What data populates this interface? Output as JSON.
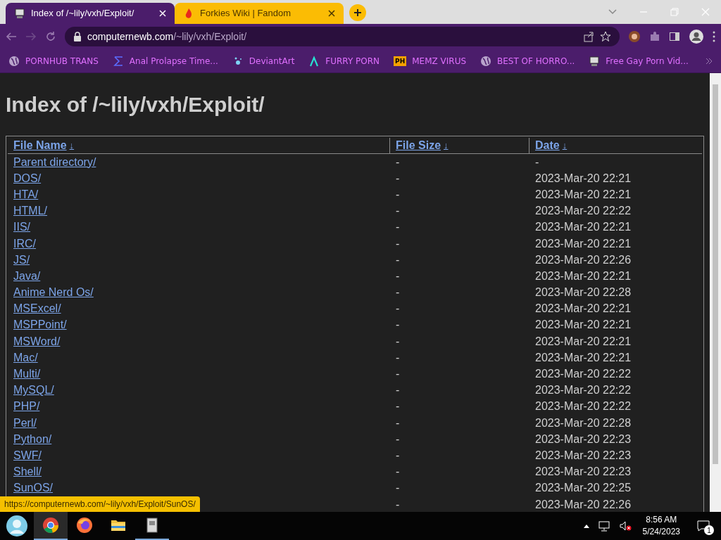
{
  "tabs": [
    {
      "title": "Index of /~lily/vxh/Exploit/",
      "selected": true
    },
    {
      "title": "Forkies Wiki | Fandom",
      "selected": false
    }
  ],
  "address": {
    "host": "computernewb.com",
    "path": "/~lily/vxh/Exploit/"
  },
  "bookmarks": [
    {
      "label": "PORNHUB TRANS",
      "kind": "globe"
    },
    {
      "label": "Anal Prolapse Time...",
      "kind": "sigma"
    },
    {
      "label": "DeviantArt",
      "kind": "sparkle"
    },
    {
      "label": "FURRY PORN",
      "kind": "lambda"
    },
    {
      "label": "MEMZ VIRUS",
      "kind": "ph",
      "badge": "PH"
    },
    {
      "label": "BEST OF HORRO...",
      "kind": "globe"
    },
    {
      "label": "Free Gay Porn Vid...",
      "kind": "computer"
    }
  ],
  "page": {
    "heading": "Index of /~lily/vxh/Exploit/",
    "columns": [
      {
        "label": "File Name",
        "sort": "↓"
      },
      {
        "label": "File Size",
        "sort": "↓"
      },
      {
        "label": "Date",
        "sort": "↓"
      }
    ],
    "rows": [
      {
        "name": "Parent directory/",
        "size": "-",
        "date": "-"
      },
      {
        "name": "DOS/",
        "size": "-",
        "date": "2023-Mar-20 22:21"
      },
      {
        "name": "HTA/",
        "size": "-",
        "date": "2023-Mar-20 22:21"
      },
      {
        "name": "HTML/",
        "size": "-",
        "date": "2023-Mar-20 22:22"
      },
      {
        "name": "IIS/",
        "size": "-",
        "date": "2023-Mar-20 22:21"
      },
      {
        "name": "IRC/",
        "size": "-",
        "date": "2023-Mar-20 22:21"
      },
      {
        "name": "JS/",
        "size": "-",
        "date": "2023-Mar-20 22:26"
      },
      {
        "name": "Java/",
        "size": "-",
        "date": "2023-Mar-20 22:21"
      },
      {
        "name": "Anime Nerd Os/",
        "size": "-",
        "date": "2023-Mar-20 22:28"
      },
      {
        "name": "MSExcel/",
        "size": "-",
        "date": "2023-Mar-20 22:21"
      },
      {
        "name": "MSPPoint/",
        "size": "-",
        "date": "2023-Mar-20 22:21"
      },
      {
        "name": "MSWord/",
        "size": "-",
        "date": "2023-Mar-20 22:21"
      },
      {
        "name": "Mac/",
        "size": "-",
        "date": "2023-Mar-20 22:21"
      },
      {
        "name": "Multi/",
        "size": "-",
        "date": "2023-Mar-20 22:22"
      },
      {
        "name": "MySQL/",
        "size": "-",
        "date": "2023-Mar-20 22:22"
      },
      {
        "name": "PHP/",
        "size": "-",
        "date": "2023-Mar-20 22:22"
      },
      {
        "name": "Perl/",
        "size": "-",
        "date": "2023-Mar-20 22:28"
      },
      {
        "name": "Python/",
        "size": "-",
        "date": "2023-Mar-20 22:23"
      },
      {
        "name": "SWF/",
        "size": "-",
        "date": "2023-Mar-20 22:23"
      },
      {
        "name": "Shell/",
        "size": "-",
        "date": "2023-Mar-20 22:23"
      },
      {
        "name": "SunOS/",
        "size": "-",
        "date": "2023-Mar-20 22:25"
      },
      {
        "size": "-",
        "date": "2023-Mar-20 22:26"
      }
    ]
  },
  "status_url": "https://computernewb.com/~lily/vxh/Exploit/SunOS/",
  "taskbar": {
    "apps": [
      {
        "kind": "chrome",
        "active": true
      },
      {
        "kind": "firefox",
        "active": false
      },
      {
        "kind": "folder",
        "active": false
      },
      {
        "kind": "file",
        "active": true
      }
    ],
    "time": "8:56 AM",
    "date": "5/24/2023",
    "notifications": "1"
  }
}
